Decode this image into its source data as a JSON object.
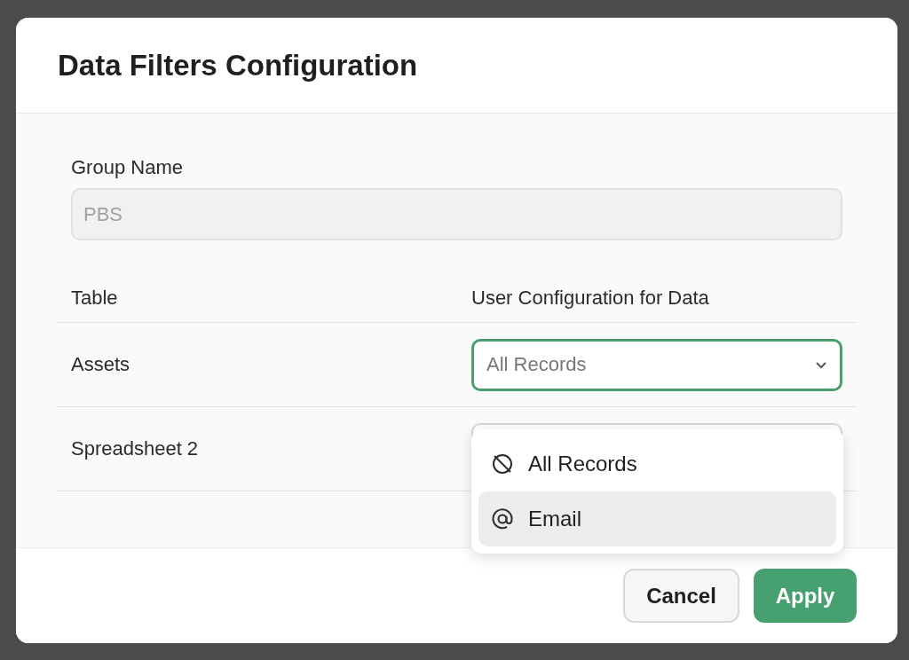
{
  "dialog": {
    "title": "Data Filters Configuration",
    "group_name": {
      "label": "Group Name",
      "value": "PBS",
      "disabled": true
    },
    "table": {
      "columns": [
        "Table",
        "User Configuration for Data"
      ],
      "rows": [
        {
          "table": "Assets",
          "config": "All Records",
          "focused": true
        },
        {
          "table": "Spreadsheet 2",
          "focused": false
        }
      ]
    },
    "dropdown": {
      "options": [
        {
          "kind": "no-filter",
          "label": "All Records",
          "selected": false
        },
        {
          "kind": "email",
          "label": "Email",
          "selected": true
        }
      ]
    },
    "buttons": [
      {
        "kind": "secondary",
        "label": "Cancel"
      },
      {
        "kind": "primary",
        "label": "Apply"
      }
    ]
  }
}
